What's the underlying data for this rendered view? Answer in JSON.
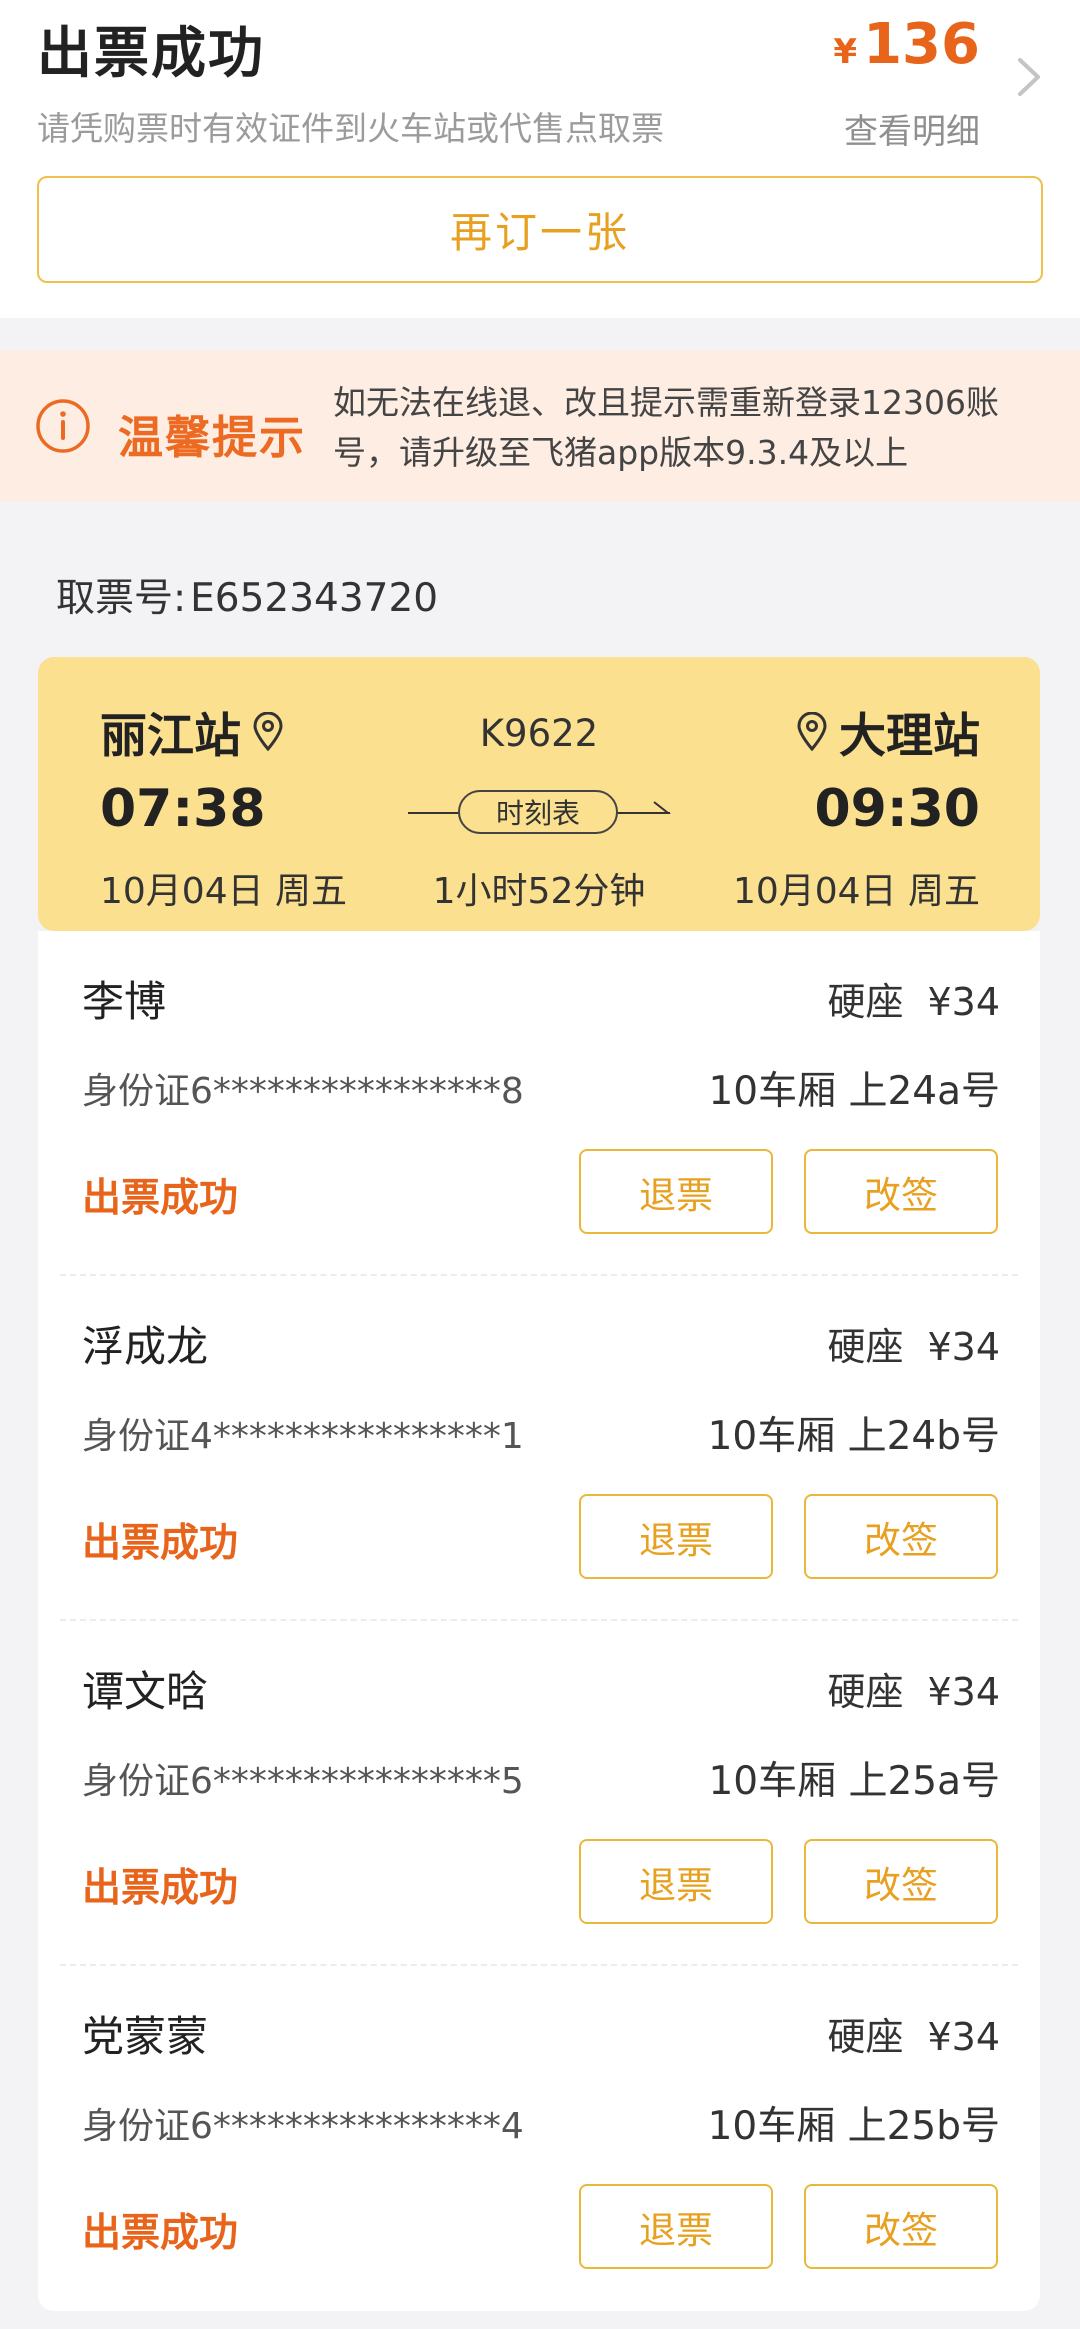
{
  "header": {
    "title": "出票成功",
    "subtitle": "请凭购票时有效证件到火车站或代售点取票",
    "currency": "¥",
    "total_price": "136",
    "detail_link": "查看明细",
    "rebook_label": "再订一张"
  },
  "notice": {
    "title": "温馨提示",
    "text": "如无法在线退、改且提示需重新登录12306账号，请升级至飞猪app版本9.3.4及以上"
  },
  "ticket": {
    "label": "取票号:",
    "number": "E652343720"
  },
  "train": {
    "from_station": "丽江站",
    "to_station": "大理站",
    "train_no": "K9622",
    "depart_time": "07:38",
    "arrive_time": "09:30",
    "schedule_label": "时刻表",
    "depart_date": "10月04日 周五",
    "arrive_date": "10月04日 周五",
    "duration": "1小时52分钟"
  },
  "passengers": [
    {
      "name": "李博",
      "seat_type": "硬座",
      "price": "¥34",
      "id": "身份证6****************8",
      "coach": "10车厢 上24a号",
      "status": "出票成功",
      "refund_label": "退票",
      "change_label": "改签"
    },
    {
      "name": "浮成龙",
      "seat_type": "硬座",
      "price": "¥34",
      "id": "身份证4****************1",
      "coach": "10车厢 上24b号",
      "status": "出票成功",
      "refund_label": "退票",
      "change_label": "改签"
    },
    {
      "name": "谭文晗",
      "seat_type": "硬座",
      "price": "¥34",
      "id": "身份证6****************5",
      "coach": "10车厢 上25a号",
      "status": "出票成功",
      "refund_label": "退票",
      "change_label": "改签"
    },
    {
      "name": "党蒙蒙",
      "seat_type": "硬座",
      "price": "¥34",
      "id": "身份证6****************4",
      "coach": "10车厢 上25b号",
      "status": "出票成功",
      "refund_label": "退票",
      "change_label": "改签"
    }
  ],
  "colors": {
    "accent_orange": "#e8641b",
    "button_gold": "#e8a020",
    "train_card_bg": "#fbe08f",
    "notice_bg": "#fdede3"
  },
  "icons": {
    "header_chevron": "chevron-right-icon",
    "notice": "info-circle-icon",
    "station_pin": "location-pin-icon"
  }
}
